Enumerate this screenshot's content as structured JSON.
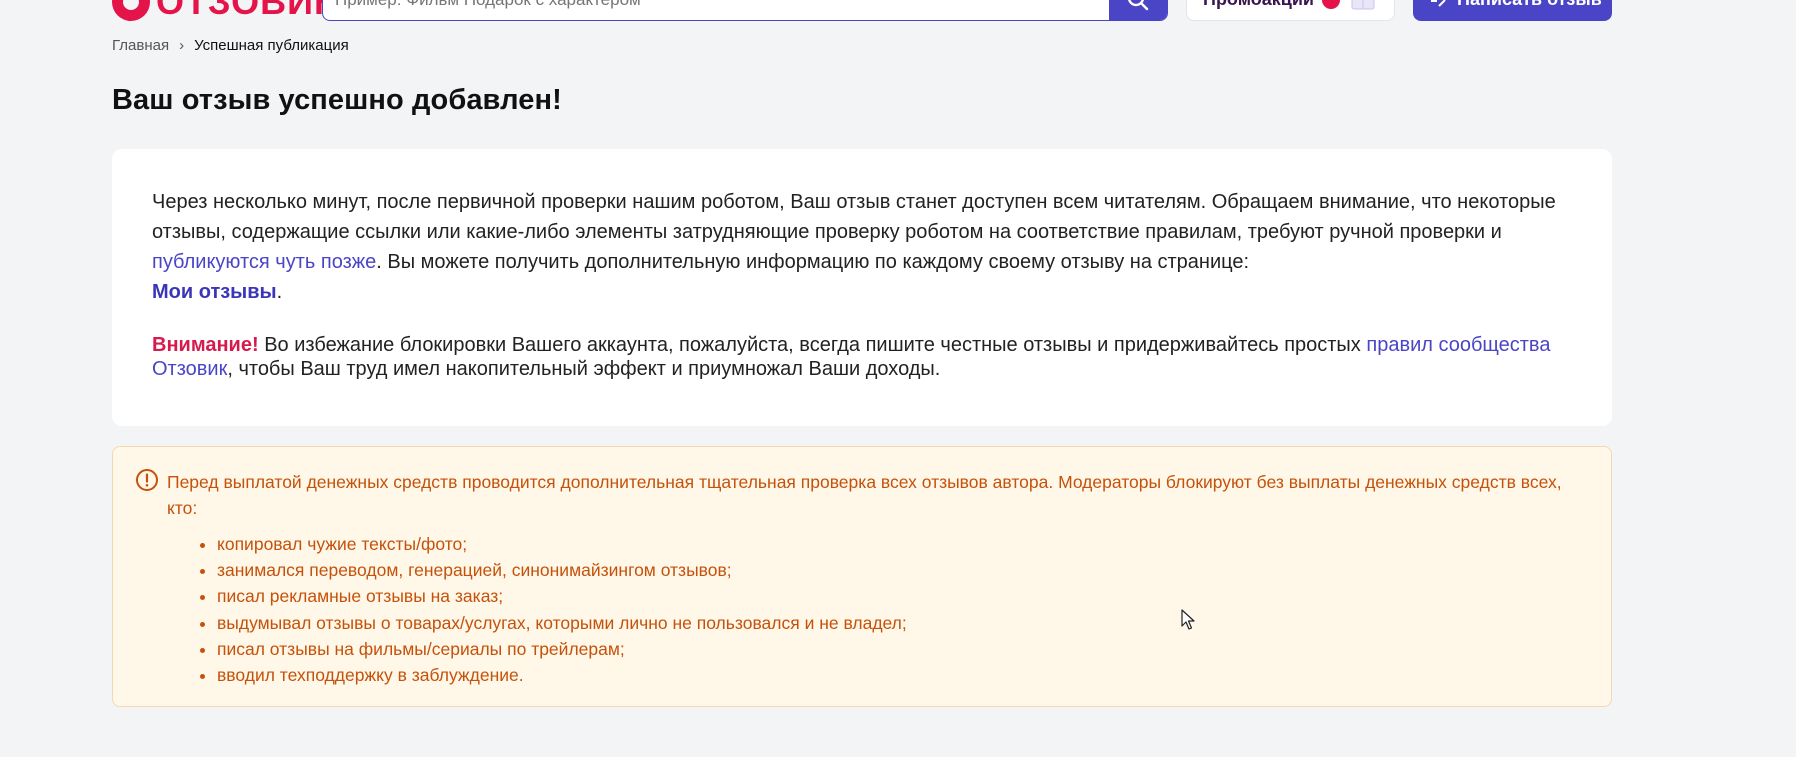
{
  "header": {
    "logo_text": "ОТЗОВИК",
    "search_placeholder": "Пример: Фильм Подарок с характером",
    "promo_label": "Промоакции",
    "write_button": "Написать отзыв"
  },
  "breadcrumb": {
    "home": "Главная",
    "separator": "›",
    "current": "Успешная публикация"
  },
  "title": "Ваш отзыв успешно добавлен!",
  "card": {
    "para1_before": "Через несколько минут, после первичной проверки нашим роботом, Ваш отзыв станет доступен всем читателям. Обращаем внимание, что некоторые отзывы, содержащие ссылки или какие-либо элементы затрудняющие проверку роботом на соответствие правилам, требуют ручной проверки и ",
    "para1_link": "публикуются чуть позже",
    "para1_after": ". Вы можете получить дополнительную информацию по каждому своему отзыву на странице: ",
    "my_reviews_link": "Мои отзывы",
    "para1_end": ".",
    "attention_word": "Внимание!",
    "para2_before": " Во избежание блокировки Вашего аккаунта, пожалуйста, всегда пишите честные отзывы и придерживайтесь простых ",
    "rules_link": "правил сообщества Отзовик",
    "para2_after": ", чтобы Ваш труд имел накопительный эффект и приумножал Ваши доходы."
  },
  "notice": {
    "text": "Перед выплатой денежных средств проводится дополнительная тщательная проверка всех отзывов автора. Модераторы блокируют без выплаты денежных средств всех, кто:",
    "items": [
      "копировал чужие тексты/фото;",
      "занимался переводом, генерацией, синонимайзингом отзывов;",
      "писал рекламные отзывы на заказ;",
      "выдумывал отзывы о товарах/услугах, которыми лично не пользовался и не владел;",
      "писал отзывы на фильмы/сериалы по трейлерам;",
      "вводил техподдержку в заблуждение."
    ]
  },
  "colors": {
    "accent": "#4a45c6",
    "brand": "#e4144b",
    "warning_text": "#c5520b",
    "warning_bg": "#fff7e8"
  }
}
